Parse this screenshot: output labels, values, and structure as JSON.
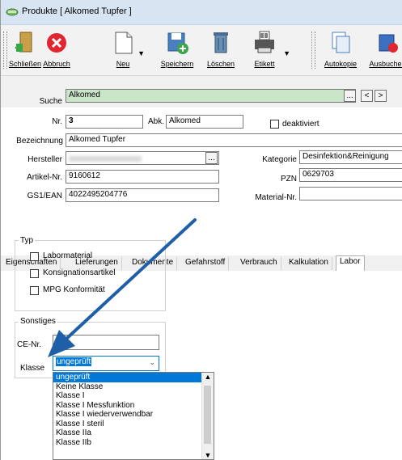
{
  "window": {
    "title": "Produkte [ Alkomed Tupfer ]"
  },
  "toolbar": {
    "buttons": [
      {
        "label": "Schließen",
        "icon": "exit-door-icon"
      },
      {
        "label": "Abbruch",
        "icon": "cancel-icon"
      },
      {
        "label": "Neu",
        "icon": "new-document-icon"
      },
      {
        "label": "Speichern",
        "icon": "save-disk-icon"
      },
      {
        "label": "Löschen",
        "icon": "trash-icon"
      },
      {
        "label": "Etikett",
        "icon": "label-printer-icon"
      },
      {
        "label": "Autokopie",
        "icon": "copy-icon"
      },
      {
        "label": "Ausbuchen",
        "icon": "book-out-icon"
      }
    ]
  },
  "search": {
    "label": "Suche",
    "value": "Alkomed",
    "btn_prev": "<",
    "btn_next": ">",
    "btn_more": "..."
  },
  "form": {
    "nr_label": "Nr.",
    "nr_value": "3",
    "abk_label": "Abk.",
    "abk_value": "Alkomed",
    "deaktiviert_label": "deaktiviert",
    "bezeichnung_label": "Bezeichnung",
    "bezeichnung_value": "Alkomed Tupfer",
    "hersteller_label": "Hersteller",
    "kategorie_label": "Kategorie",
    "kategorie_value": "Desinfektion&Reinigung",
    "artikelnr_label": "Artikel-Nr.",
    "artikelnr_value": "9160612",
    "pzn_label": "PZN",
    "pzn_value": "0629703",
    "gs1_label": "GS1/EAN",
    "gs1_value": "4022495204776",
    "materialnr_label": "Material-Nr."
  },
  "tabs": [
    "Eigenschaften",
    "Lieferungen",
    "Dokumente",
    "Gefahrstoff",
    "Verbrauch",
    "Kalkulation",
    "Labor"
  ],
  "labor": {
    "typ_title": "Typ",
    "checkboxes": [
      "Labormaterial",
      "Konsignationsartikel",
      "MPG Konformität"
    ],
    "sonstiges_title": "Sonstiges",
    "ce_label": "CE-Nr.",
    "klasse_label": "Klasse",
    "klasse_value": "ungeprüft",
    "klasse_options": [
      "ungeprüft",
      "Keine Klasse",
      "Klasse I",
      "Klasse I Messfunktion",
      "Klasse I wiederverwendbar",
      "Klasse I steril",
      "Klasse IIa",
      "Klasse IIb"
    ]
  },
  "colors": {
    "accent_arrow": "#1f5fa8",
    "selection": "#0078d7",
    "search_bg": "#c9e6c9"
  }
}
